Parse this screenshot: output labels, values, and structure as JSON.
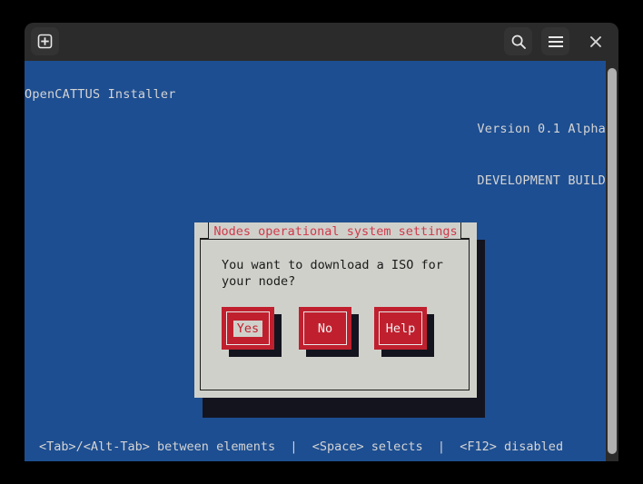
{
  "window": {
    "title_bar": {
      "new_tab_icon": "add-square-icon",
      "search_icon": "search-icon",
      "menu_icon": "hamburger-menu-icon",
      "close_icon": "close-icon"
    }
  },
  "tui": {
    "app_title": "OpenCATTUS Installer",
    "version_line_1": "Version 0.1 Alpha",
    "version_line_2": "DEVELOPMENT BUILD",
    "status_bar": "<Tab>/<Alt-Tab> between elements  |  <Space> selects  |  <F12> disabled",
    "colors": {
      "background": "#1d4e91",
      "foreground": "#d4d4d4",
      "dialog_background": "#d0d0cb",
      "accent_red": "#c0202e",
      "title_red": "#cf3a4a",
      "shadow": "#14141f"
    }
  },
  "dialog": {
    "title": "Nodes operational system settings",
    "message": "You want to download a ISO for\nyour node?",
    "buttons": [
      {
        "label": "Yes",
        "focused": true
      },
      {
        "label": "No",
        "focused": false
      },
      {
        "label": "Help",
        "focused": false
      }
    ]
  }
}
